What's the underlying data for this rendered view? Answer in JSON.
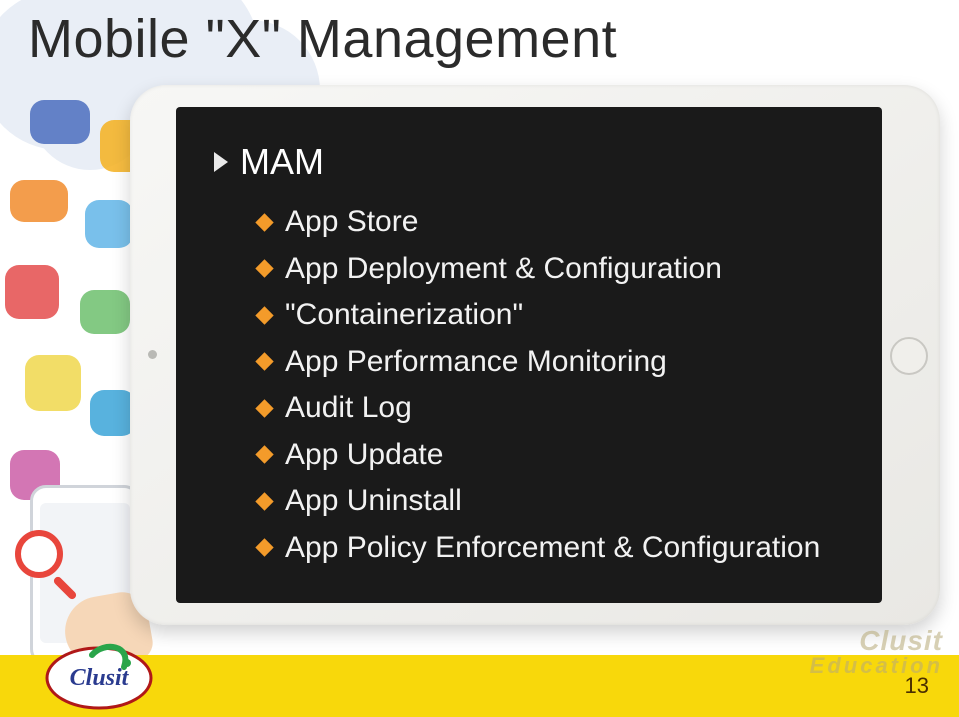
{
  "title": "Mobile \"X\" Management",
  "section": {
    "heading": "MAM",
    "bullet_color": "#f39b2a",
    "items": [
      "App Store",
      "App Deployment & Configuration",
      "\"Containerization\"",
      "App Performance Monitoring",
      "Audit Log",
      "App Update",
      "App Uninstall",
      "App Policy Enforcement & Configuration"
    ]
  },
  "footer": {
    "page_number": "13",
    "logo_text": "Clusit",
    "watermark_line1": "Clusit",
    "watermark_line2": "Education"
  }
}
